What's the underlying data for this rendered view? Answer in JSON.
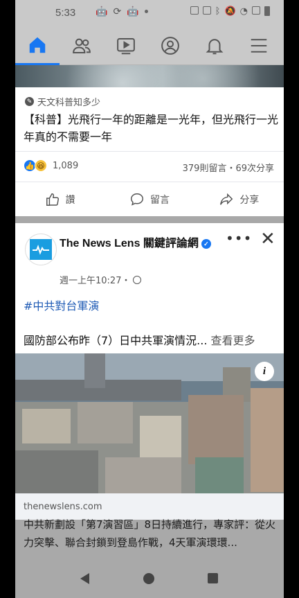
{
  "status_bar": {
    "time": "5:33"
  },
  "nav": {
    "active_tab": "home",
    "tabs": [
      "home",
      "friends",
      "watch",
      "profile",
      "notifications",
      "menu"
    ]
  },
  "post1": {
    "source": "天文科普知多少",
    "title": "【科普】光飛行一年的距離是一光年，但光飛行一光年真的不需要一年",
    "reaction_count": "1,089",
    "stats": "379則留言・69次分享",
    "actions": {
      "like": "讚",
      "comment": "留言",
      "share": "分享"
    }
  },
  "post2": {
    "page_name": "The News Lens 關鍵評論網",
    "time": "週一上午10:27・",
    "hashtag": "#中共對台軍演",
    "body": "國防部公布昨（7）日中共軍演情況...",
    "see_more": " 查看更多",
    "link_domain": "thenewslens.com",
    "link_title": "中共新劃設「第7演習區」8日持續進行，專家評：從火力突擊、聯合封鎖到登島作戰，4天軍演環環..."
  },
  "colors": {
    "accent": "#1877f2",
    "hashtag": "#1f5bb5"
  }
}
